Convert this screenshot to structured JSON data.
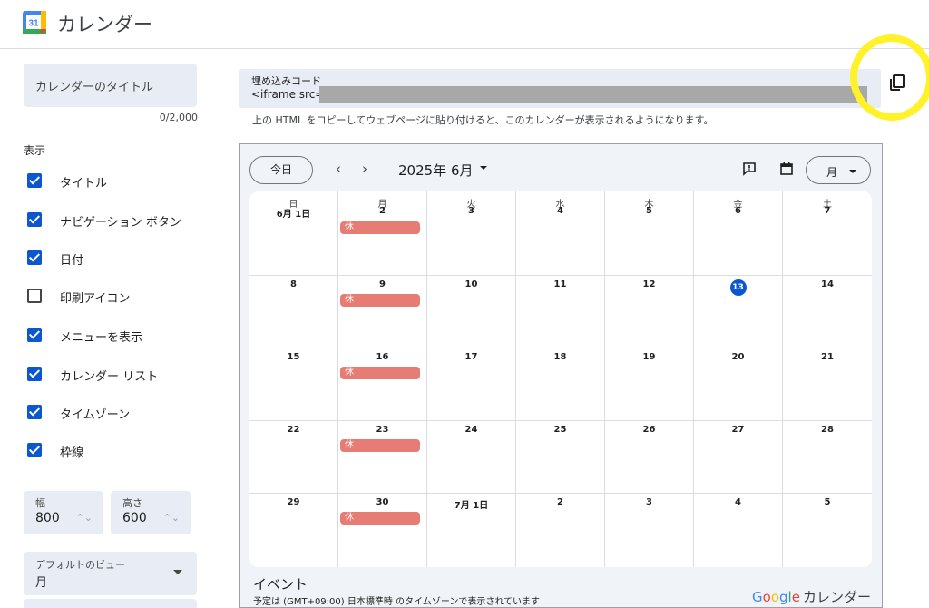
{
  "header": {
    "logo_text": "31",
    "title": "カレンダー"
  },
  "left_panel": {
    "title_placeholder": "カレンダーのタイトル",
    "char_count": "0/2,000",
    "display_label": "表示",
    "options": [
      {
        "label": "タイトル",
        "checked": true
      },
      {
        "label": "ナビゲーション ボタン",
        "checked": true
      },
      {
        "label": "日付",
        "checked": true
      },
      {
        "label": "印刷アイコン",
        "checked": false
      },
      {
        "label": "メニューを表示",
        "checked": true
      },
      {
        "label": "カレンダー リスト",
        "checked": true
      },
      {
        "label": "タイムゾーン",
        "checked": true
      },
      {
        "label": "枠線",
        "checked": true
      }
    ],
    "width_label": "幅",
    "width_value": "800",
    "height_label": "高さ",
    "height_value": "600",
    "default_view_label": "デフォルトのビュー",
    "default_view_value": "月"
  },
  "embed": {
    "label": "埋め込みコード",
    "code_prefix": "<iframe src=\"",
    "help": "上の HTML をコピーしてウェブページに貼り付けると、このカレンダーが表示されるようになります。"
  },
  "calendar": {
    "today_button": "今日",
    "prev_icon": "‹",
    "next_icon": "›",
    "month_title": "2025年 6月",
    "view_button": "月",
    "weekdays": [
      "日",
      "月",
      "火",
      "水",
      "木",
      "金",
      "土"
    ],
    "weeks": [
      [
        "6月 1日",
        "2",
        "3",
        "4",
        "5",
        "6",
        "7"
      ],
      [
        "8",
        "9",
        "10",
        "11",
        "12",
        "13",
        "14"
      ],
      [
        "15",
        "16",
        "17",
        "18",
        "19",
        "20",
        "21"
      ],
      [
        "22",
        "23",
        "24",
        "25",
        "26",
        "27",
        "28"
      ],
      [
        "29",
        "30",
        "7月 1日",
        "2",
        "3",
        "4",
        "5"
      ]
    ],
    "today": "13",
    "holiday_label": "休",
    "holiday_color": "#e67c73",
    "today_color": "#0b57d0",
    "events_title": "イベント",
    "timezone_note": "予定は (GMT+09:00) 日本標準時 のタイムゾーンで表示されています",
    "brand_google": "Google",
    "brand_product": "カレンダー"
  },
  "colors": {
    "accent": "#0b57d0",
    "field_bg": "#e8ecf4",
    "highlight": "#fff22a"
  },
  "icons": {
    "copy": "copy-icon",
    "feedback": "feedback-icon",
    "agenda": "calendar-icon"
  }
}
